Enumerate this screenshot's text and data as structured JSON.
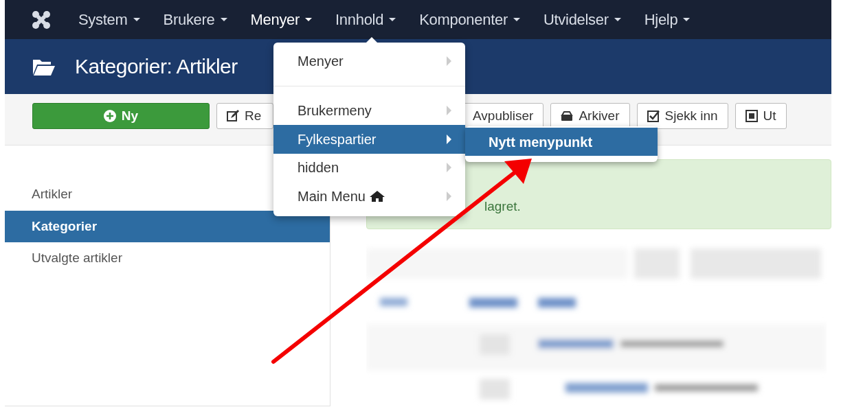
{
  "navbar": {
    "items": [
      {
        "label": "System",
        "selected": false
      },
      {
        "label": "Brukere",
        "selected": false
      },
      {
        "label": "Menyer",
        "selected": true
      },
      {
        "label": "Innhold",
        "selected": false
      },
      {
        "label": "Komponenter",
        "selected": false
      },
      {
        "label": "Utvidelser",
        "selected": false
      },
      {
        "label": "Hjelp",
        "selected": false
      }
    ]
  },
  "page_title": "Kategorier: Artikler",
  "toolbar": [
    {
      "label": "Ny",
      "kind": "new"
    },
    {
      "label": "Re",
      "kind": "edit"
    },
    {
      "label": "Avpubliser",
      "kind": "unpublish"
    },
    {
      "label": "Arkiver",
      "kind": "archive"
    },
    {
      "label": "Sjekk inn",
      "kind": "checkin"
    },
    {
      "label": "Ut",
      "kind": "options"
    }
  ],
  "sidebar": {
    "items": [
      {
        "label": "Artikler",
        "selected": false
      },
      {
        "label": "Kategorier",
        "selected": true
      },
      {
        "label": "Utvalgte artikler",
        "selected": false
      }
    ]
  },
  "alert": {
    "text": "lagret."
  },
  "menu": {
    "items": [
      {
        "label": "Menyer",
        "selected": false,
        "divider_before": false,
        "home": false
      },
      {
        "label": "Brukermeny",
        "selected": false,
        "divider_before": true,
        "home": false
      },
      {
        "label": "Fylkespartier",
        "selected": true,
        "divider_before": false,
        "home": false
      },
      {
        "label": "hidden",
        "selected": false,
        "divider_before": false,
        "home": false
      },
      {
        "label": "Main Menu",
        "selected": false,
        "divider_before": false,
        "home": true
      }
    ]
  },
  "submenu": {
    "items": [
      {
        "label": "Nytt menypunkt",
        "selected": true
      }
    ]
  }
}
